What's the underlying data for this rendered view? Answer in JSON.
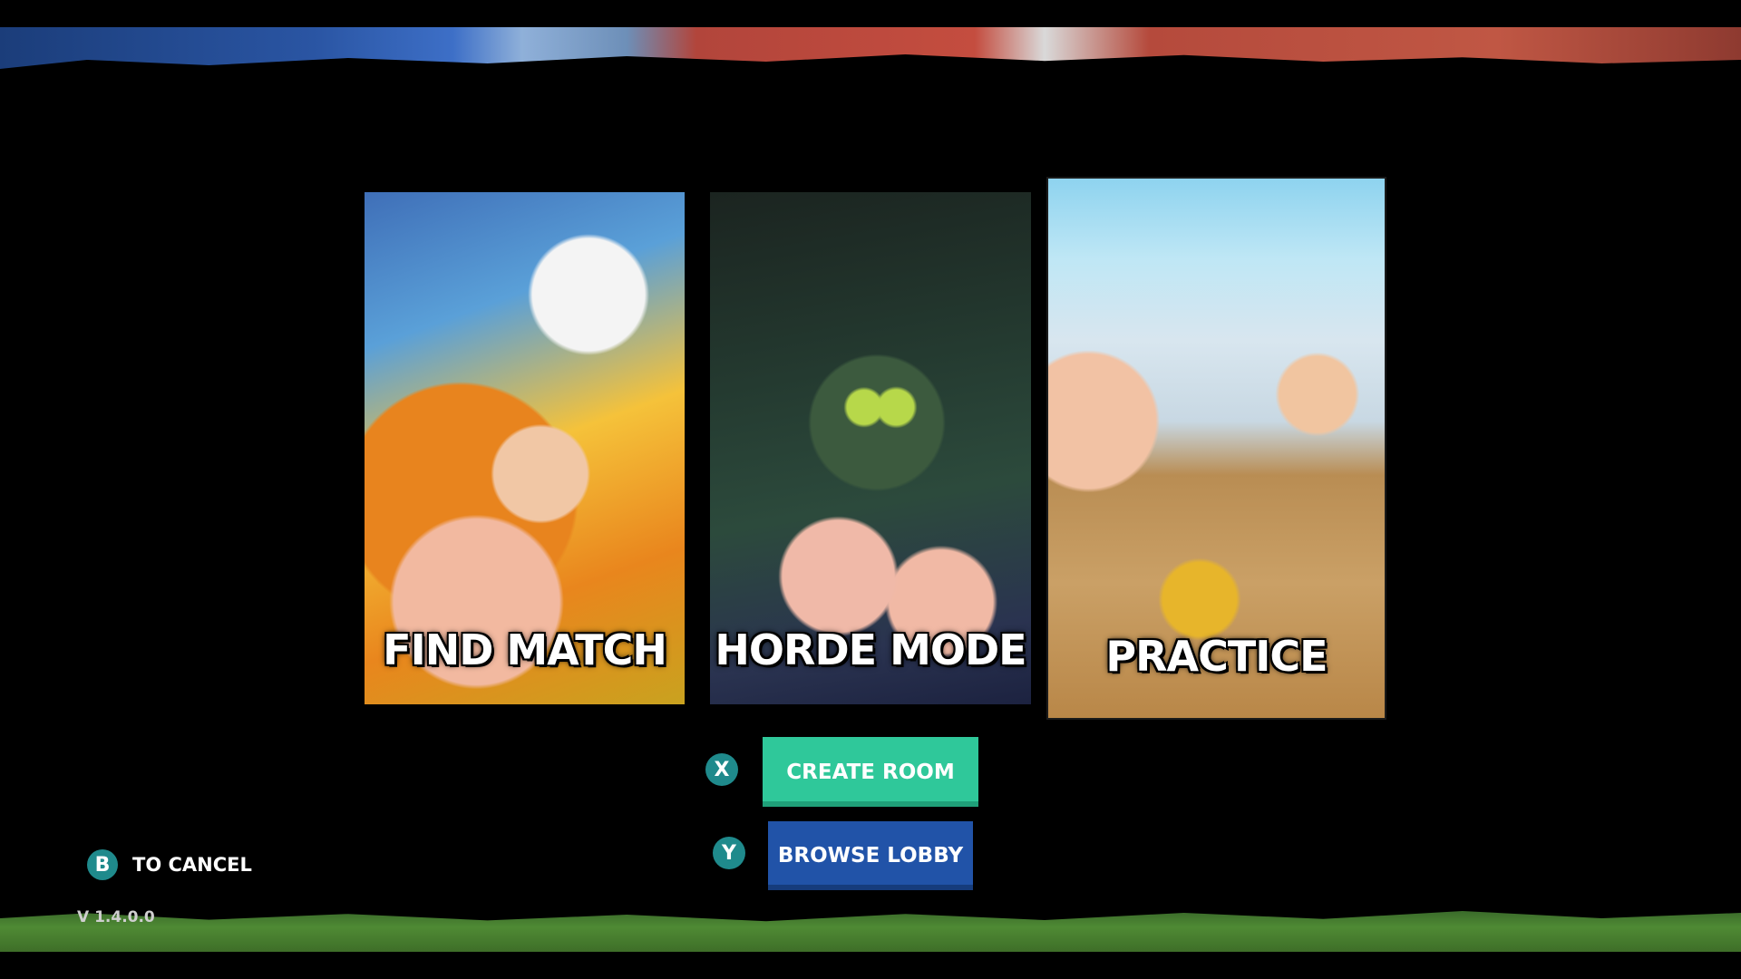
{
  "modes": {
    "find_match": "FIND MATCH",
    "horde_mode": "HORDE MODE",
    "practice": "PRACTICE"
  },
  "actions": {
    "create_room": {
      "glyph": "X",
      "label": "CREATE ROOM"
    },
    "browse_lobby": {
      "glyph": "Y",
      "label": "BROWSE LOBBY"
    }
  },
  "cancel": {
    "glyph": "B",
    "label": "TO CANCEL"
  },
  "version": "V 1.4.0.0",
  "colors": {
    "create_room_bg": "#2fc89a",
    "browse_lobby_bg": "#2153a8",
    "glyph_bg": "#1f8a8c",
    "background": "#000000"
  }
}
